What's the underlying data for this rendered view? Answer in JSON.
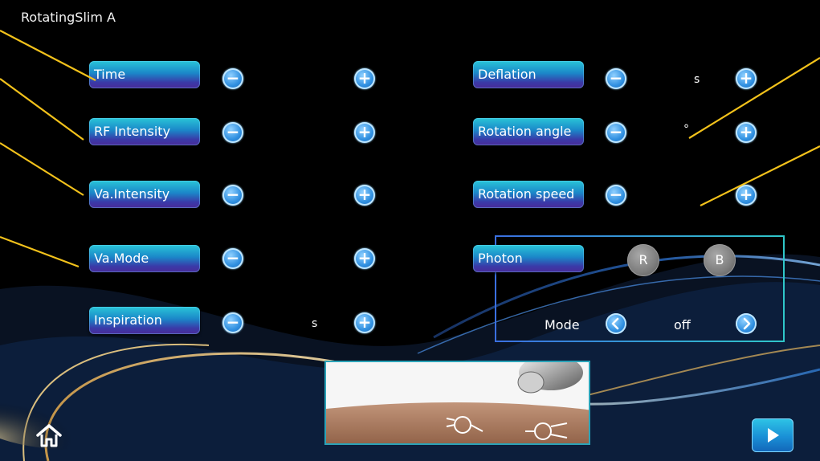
{
  "app": {
    "title": "RotatingSlim A"
  },
  "left_params": [
    {
      "label": "Time",
      "value": ""
    },
    {
      "label": "RF Intensity",
      "value": ""
    },
    {
      "label": "Va.Intensity",
      "value": ""
    },
    {
      "label": "Va.Mode",
      "value": ""
    },
    {
      "label": "Inspiration",
      "value": "s"
    }
  ],
  "right_params": [
    {
      "label": "Deflation",
      "value": "s"
    },
    {
      "label": "Rotation angle",
      "value": "°"
    },
    {
      "label": "Rotation speed",
      "value": ""
    }
  ],
  "photon": {
    "label": "Photon",
    "color_r": "R",
    "color_b": "B",
    "mode_label": "Mode",
    "mode_value": "off"
  },
  "controls": {
    "minus_symbol": "−",
    "plus_symbol": "+"
  },
  "icons": {
    "home": "home-icon",
    "play": "play-icon",
    "prev": "chevron-left-icon",
    "next": "chevron-right-icon"
  },
  "colors": {
    "accent": "#2fa3e0",
    "callout": "#f3c21b",
    "background": "#000000"
  }
}
